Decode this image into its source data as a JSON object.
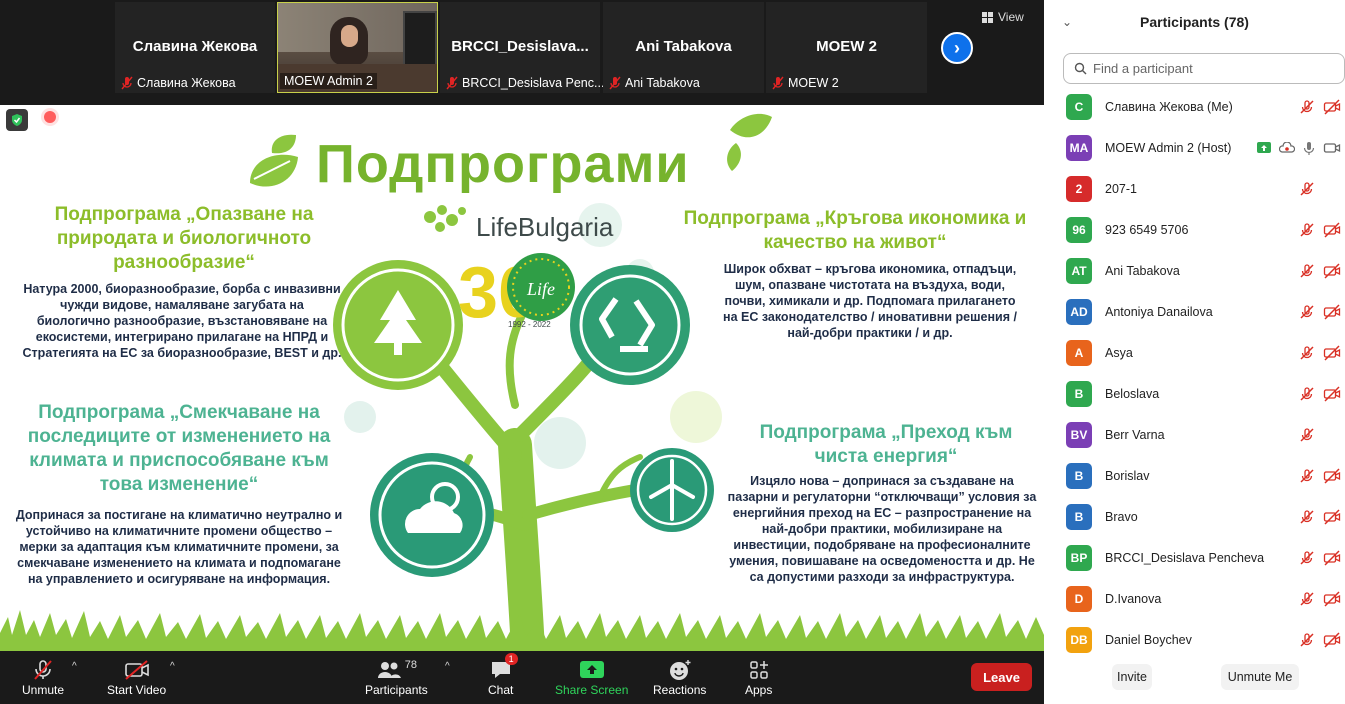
{
  "strip": {
    "tiles": [
      {
        "name": "Славина Жекова",
        "label": "Славина Жекова"
      },
      {
        "name": "",
        "label": "MOEW Admin 2"
      },
      {
        "name": "BRCCI_Desislava...",
        "label": "BRCCI_Desislava Penc..."
      },
      {
        "name": "Ani Tabakova",
        "label": "Ani Tabakova"
      },
      {
        "name": "MOEW 2",
        "label": "MOEW 2"
      }
    ],
    "next_label": "›",
    "view_label": "View"
  },
  "slide": {
    "title": "Подпрограми",
    "logo_text": "LifeBulgaria",
    "anniversary_years": "1992 - 2022",
    "anniversary_number": "30",
    "anniversary_badge": "Life",
    "block1": {
      "heading": "Подпрограма  „Опазване на природата и биологичното разнообразие“",
      "body": "Натура 2000, биоразнообразие, борба с инвазивни чужди видове, намаляване загубата на биологично разнообразие, възстановяване на екосистеми, интегрирано прилагане на НПРД и Стратегията на ЕС за биоразнообразие, BEST и др."
    },
    "block2": {
      "heading": "Подпрограма „Смекчаване на последиците от изменението на климата и приспособяване към това изменение“",
      "body": "Допринася за постигане на климатично неутрално и устойчиво на климатичните промени общество – мерки за адаптация към климатичните промени, за смекчаване изменението на климата и подпомагане на управлението и осигуряване на информация."
    },
    "block3": {
      "heading": "Подпрограма  „Кръгова икономика и качество на живот“",
      "body": "Широк обхват – кръгова икономика, отпадъци, шум, опазване чистотата на въздуха, води, почви, химикали и др. Подпомага прилагането на ЕС законодателство / иновативни решения / най-добри практики / и др."
    },
    "block4": {
      "heading": "Подпрограма „Преход към чиста енергия“",
      "body": "Изцяло нова – допринася за създаване на пазарни и регулаторни “отключващи” условия за енергийния преход на ЕС – разпространение на най-добри практики, мобилизиране на инвестиции, подобряване на професионалните умения, повишаване на осведомеността и др. Не са допустими разходи за инфраструктура."
    }
  },
  "toolbar": {
    "unmute": "Unmute",
    "start_video": "Start Video",
    "participants": "Participants",
    "participants_count": "78",
    "chat": "Chat",
    "chat_badge": "1",
    "share_screen": "Share Screen",
    "reactions": "Reactions",
    "apps": "Apps",
    "leave": "Leave",
    "caret": "^"
  },
  "panel": {
    "title": "Participants (78)",
    "search_placeholder": "Find a participant",
    "invite": "Invite",
    "unmute_me": "Unmute Me",
    "participants": [
      {
        "initials": "С",
        "name": "Славина Жекова (Me)",
        "color": "#2fa84f",
        "video": true
      },
      {
        "initials": "MA",
        "name": "MOEW Admin 2 (Host)",
        "color": "#7b3fb5",
        "video": true,
        "host": true
      },
      {
        "initials": "2",
        "name": "207-1",
        "color": "#d62b2b",
        "video": false
      },
      {
        "initials": "96",
        "name": "923 6549 5706",
        "color": "#2fa84f",
        "video": true
      },
      {
        "initials": "AT",
        "name": "Ani Tabakova",
        "color": "#2fa84f",
        "video": true
      },
      {
        "initials": "AD",
        "name": "Antoniya Danailova",
        "color": "#2a6fbd",
        "video": true
      },
      {
        "initials": "A",
        "name": "Asya",
        "color": "#e8641c",
        "video": true
      },
      {
        "initials": "B",
        "name": "Beloslava",
        "color": "#2fa84f",
        "video": true
      },
      {
        "initials": "BV",
        "name": "Berr Varna",
        "color": "#7b3fb5",
        "video": false
      },
      {
        "initials": "B",
        "name": "Borislav",
        "color": "#2a6fbd",
        "video": true
      },
      {
        "initials": "B",
        "name": "Bravo",
        "color": "#2a6fbd",
        "video": true
      },
      {
        "initials": "BP",
        "name": "BRCCI_Desislava Pencheva",
        "color": "#2fa84f",
        "video": true
      },
      {
        "initials": "D",
        "name": "D.Ivanova",
        "color": "#e8641c",
        "video": true
      },
      {
        "initials": "DB",
        "name": "Daniel Boychev",
        "color": "#f2a20f",
        "video": true
      }
    ]
  }
}
